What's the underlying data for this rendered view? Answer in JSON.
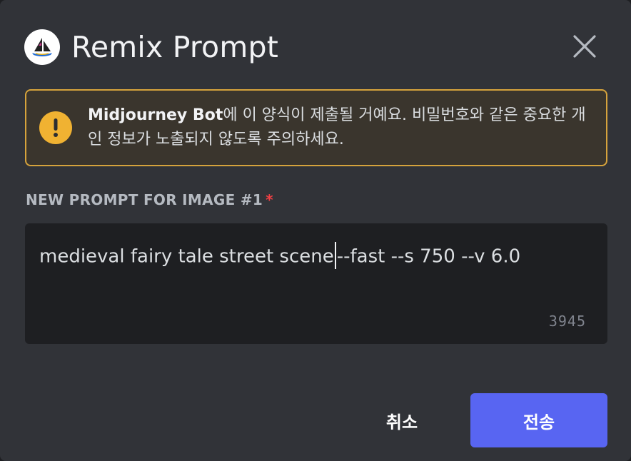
{
  "modal": {
    "title": "Remix Prompt",
    "app_icon": "midjourney-sailboat-icon",
    "close_icon": "close-icon"
  },
  "notice": {
    "icon": "exclamation-icon",
    "bot_name": "Midjourney Bot",
    "message": "에 이 양식이 제출될 거예요. 비밀번호와 같은 중요한 개인 정보가 노출되지 않도록 주의하세요."
  },
  "field": {
    "label": "NEW PROMPT FOR IMAGE #1",
    "required_marker": "*",
    "value_before_caret": "medieval fairy tale street scene",
    "value_after_caret": "--fast --s 750 --v 6.0",
    "remaining_chars": "3945"
  },
  "actions": {
    "cancel_label": "취소",
    "submit_label": "전송"
  },
  "colors": {
    "modal_bg": "#313338",
    "warning_border": "#d6a33c",
    "warning_icon": "#f0b232",
    "input_bg": "#1e1f22",
    "primary_button": "#5865f2",
    "required": "#f23f43"
  }
}
